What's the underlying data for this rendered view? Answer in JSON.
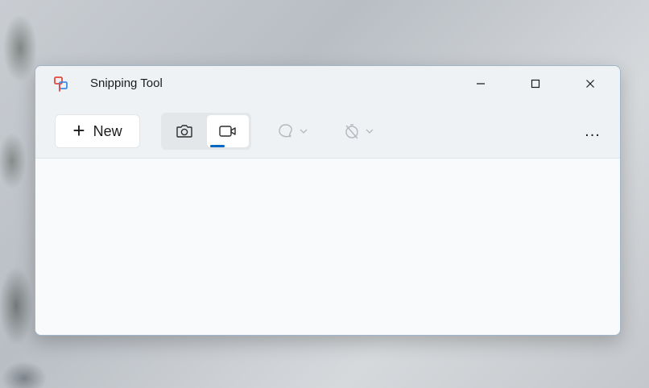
{
  "window": {
    "title": "Snipping Tool"
  },
  "toolbar": {
    "new_label": "New",
    "mode_buttons": [
      {
        "name": "snip",
        "icon": "camera-icon",
        "selected": false
      },
      {
        "name": "record",
        "icon": "video-camera-icon",
        "selected": true
      }
    ],
    "shape_dropdown_icon": "free-form-shape-icon",
    "timer_dropdown_icon": "no-delay-timer-icon",
    "more_label": "..."
  },
  "colors": {
    "accent": "#0067c0",
    "window_bg": "#fbfcfd",
    "toolbar_bg": "#eef2f5"
  }
}
